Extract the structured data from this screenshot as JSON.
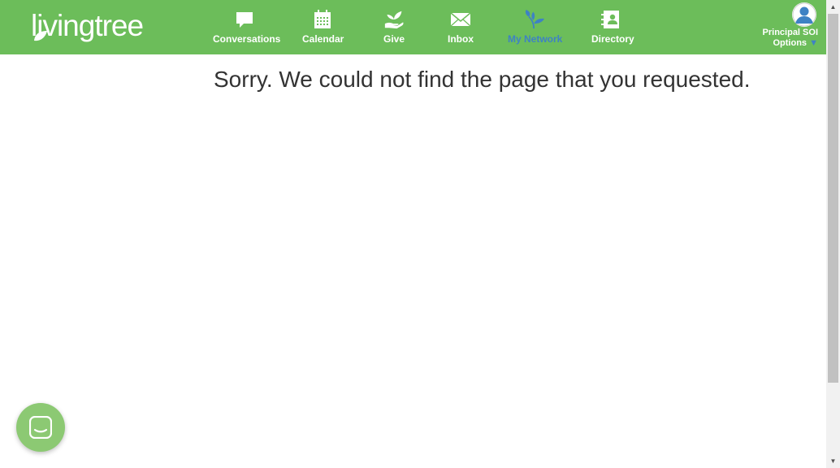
{
  "brand": {
    "name": "livingtree"
  },
  "nav": {
    "items": [
      {
        "label": "Conversations",
        "icon": "speech-bubble-icon"
      },
      {
        "label": "Calendar",
        "icon": "calendar-icon"
      },
      {
        "label": "Give",
        "icon": "hand-sprout-icon"
      },
      {
        "label": "Inbox",
        "icon": "envelope-icon"
      },
      {
        "label": "My Network",
        "icon": "tree-network-icon",
        "active": true
      },
      {
        "label": "Directory",
        "icon": "address-book-icon"
      }
    ]
  },
  "user": {
    "name": "Principal SOI",
    "options_label": "Options",
    "caret": "▼"
  },
  "main": {
    "message": "Sorry. We could not find the page that you requested."
  },
  "colors": {
    "header": "#6cbd5a",
    "active": "#3e82c4",
    "chat": "#8cc973"
  }
}
